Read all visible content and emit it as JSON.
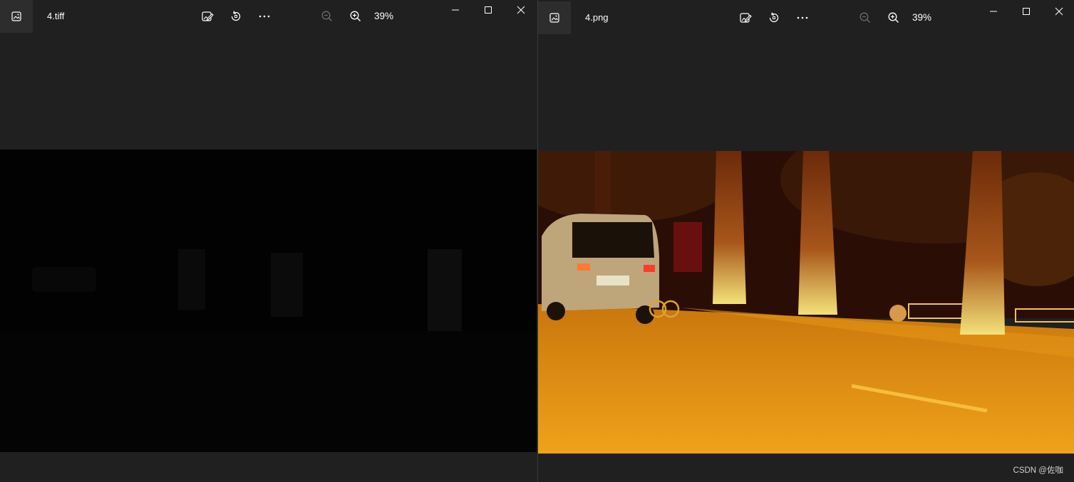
{
  "windows": [
    {
      "id": "left",
      "filename": "4.tiff",
      "zoom_level": "39%",
      "icons": [
        "image-icon",
        "edit-icon",
        "rotate-icon",
        "more-icon",
        "zoom-out-icon",
        "zoom-in-icon",
        "minimize-icon",
        "maximize-icon",
        "close-icon"
      ]
    },
    {
      "id": "right",
      "filename": "4.png",
      "zoom_level": "39%",
      "icons": [
        "image-icon",
        "edit-icon",
        "rotate-icon",
        "more-icon",
        "zoom-out-icon",
        "zoom-in-icon",
        "minimize-icon",
        "maximize-icon",
        "close-icon"
      ]
    }
  ],
  "watermark": "CSDN @佐咖",
  "colors": {
    "background": "#202020",
    "app_icon_bg": "#2d2d2d",
    "icon": "#ffffff",
    "icon_disabled": "#6b6b6b",
    "left_photo": "#020202",
    "right_photo_road": "#d9840f"
  }
}
